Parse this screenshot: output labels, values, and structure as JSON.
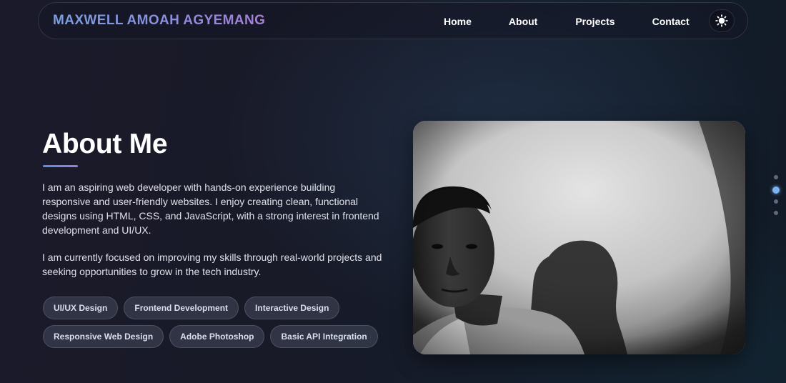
{
  "navbar": {
    "brand": "MAXWELL AMOAH AGYEMANG",
    "links": [
      "Home",
      "About",
      "Projects",
      "Contact"
    ],
    "theme_toggle_icon": "sun-icon"
  },
  "about": {
    "title": "About Me",
    "paragraphs": [
      "I am an aspiring web developer with hands-on experience building responsive and user-friendly websites. I enjoy creating clean, functional designs using HTML, CSS, and JavaScript, with a strong interest in frontend development and UI/UX.",
      "I am currently focused on improving my skills through real-world projects and seeking opportunities to grow in the tech industry."
    ],
    "skills": [
      "UI/UX Design",
      "Frontend Development",
      "Interactive Design",
      "Responsive Web Design",
      "Adobe Photoshop",
      "Basic API Integration"
    ]
  },
  "section_nav": {
    "count": 4,
    "active_index": 1
  },
  "colors": {
    "accent_blue": "#7b9fe2",
    "accent_purple": "#a77fd6",
    "active_dot": "#7bb2f2"
  }
}
